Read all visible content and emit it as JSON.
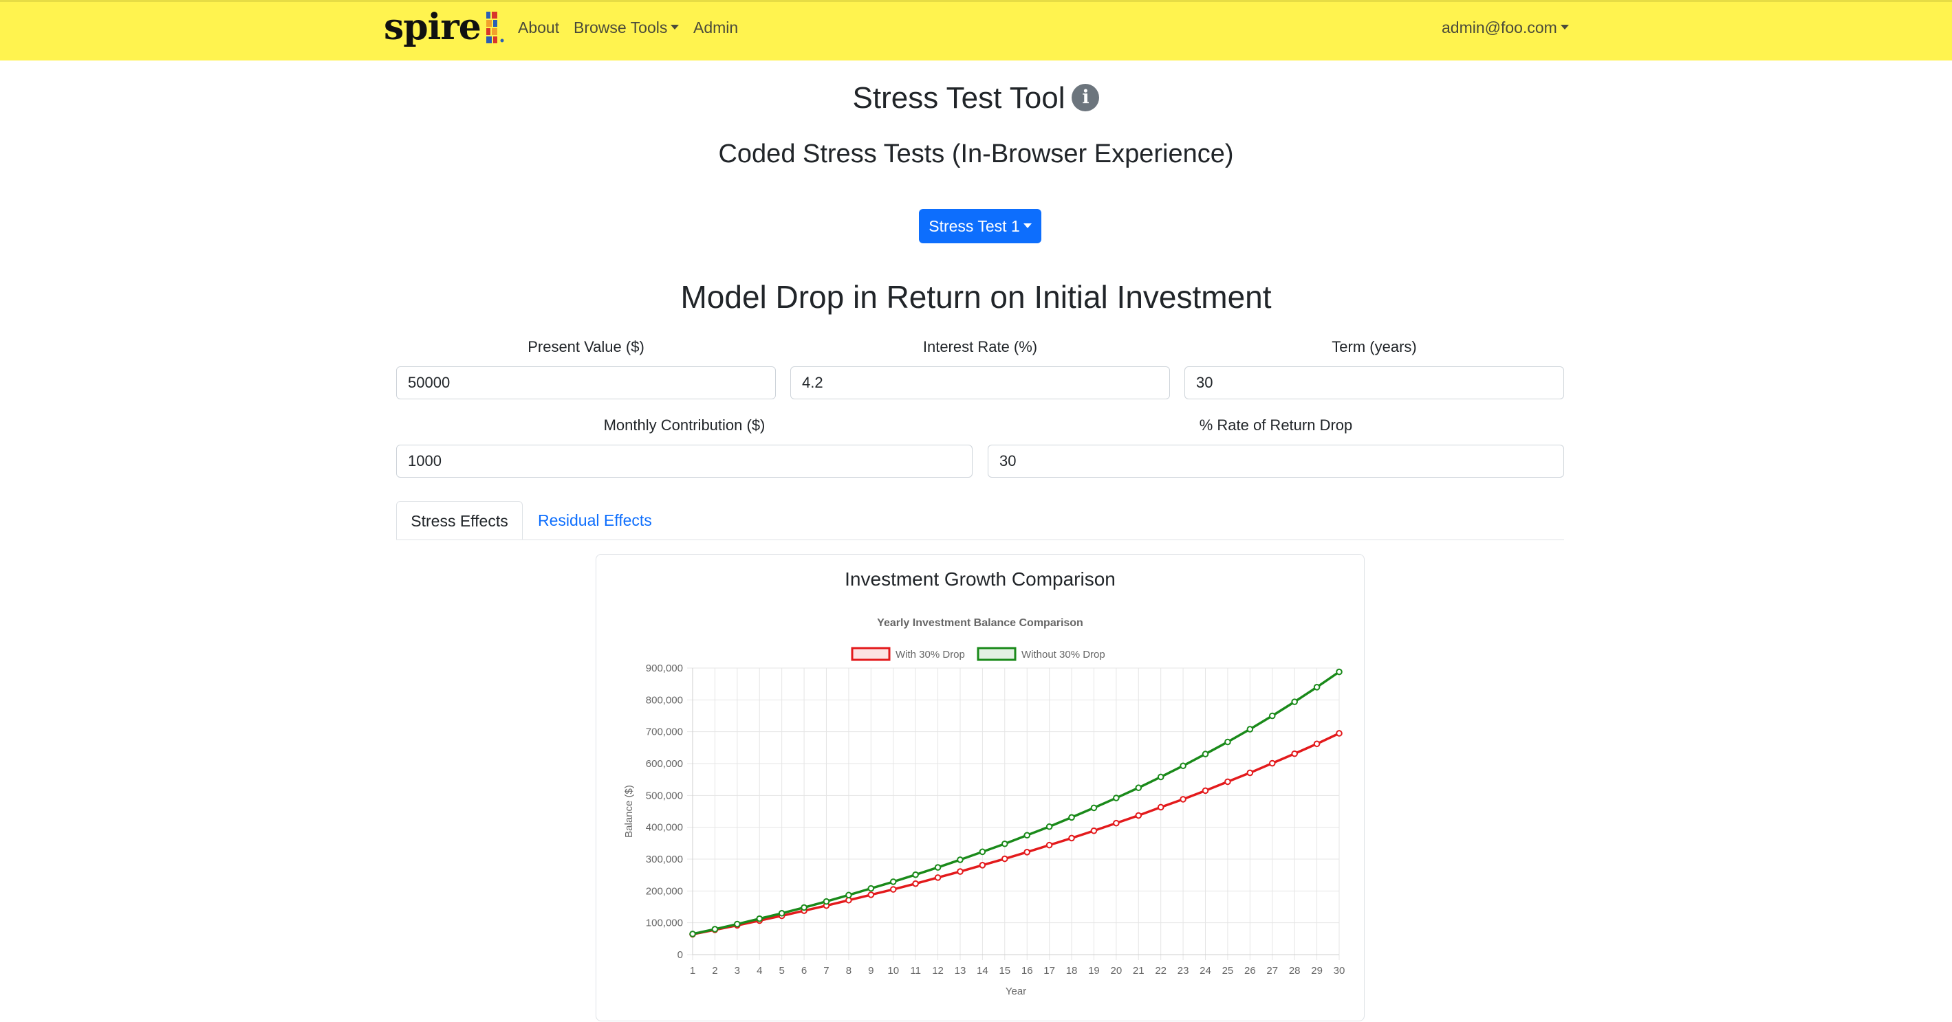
{
  "nav": {
    "brand": "spire",
    "items": [
      {
        "label": "About",
        "dropdown": false
      },
      {
        "label": "Browse Tools",
        "dropdown": true
      },
      {
        "label": "Admin",
        "dropdown": false
      }
    ],
    "user": "admin@foo.com"
  },
  "page": {
    "title": "Stress Test Tool",
    "subtitle": "Coded Stress Tests (In-Browser Experience)",
    "dropdown_label": "Stress Test 1",
    "section_title": "Model Drop in Return on Initial Investment"
  },
  "form": {
    "present_value": {
      "label": "Present Value ($)",
      "value": "50000"
    },
    "interest_rate": {
      "label": "Interest Rate (%)",
      "value": "4.2"
    },
    "term": {
      "label": "Term (years)",
      "value": "30"
    },
    "monthly_contribution": {
      "label": "Monthly Contribution ($)",
      "value": "1000"
    },
    "rate_drop": {
      "label": "% Rate of Return Drop",
      "value": "30"
    }
  },
  "tabs": [
    {
      "label": "Stress Effects",
      "active": true
    },
    {
      "label": "Residual Effects",
      "active": false
    }
  ],
  "card": {
    "title": "Investment Growth Comparison"
  },
  "colors": {
    "navbar": "#fff34f",
    "primary": "#0d6efd",
    "with_drop": "#e31a1c",
    "without_drop": "#1a8a1a"
  },
  "chart_data": {
    "type": "line",
    "title": "Yearly Investment Balance Comparison",
    "xlabel": "Year",
    "ylabel": "Balance ($)",
    "ylim": [
      0,
      900000
    ],
    "yticks": [
      0,
      100000,
      200000,
      300000,
      400000,
      500000,
      600000,
      700000,
      800000,
      900000
    ],
    "grid": true,
    "legend_position": "top",
    "x": [
      1,
      2,
      3,
      4,
      5,
      6,
      7,
      8,
      9,
      10,
      11,
      12,
      13,
      14,
      15,
      16,
      17,
      18,
      19,
      20,
      21,
      22,
      23,
      24,
      25,
      26,
      27,
      28,
      29,
      30
    ],
    "series": [
      {
        "name": "With 30% Drop",
        "color": "#e31a1c",
        "values": [
          64000,
          78000,
          92000,
          107000,
          122000,
          138000,
          154000,
          171000,
          188000,
          205000,
          223000,
          242000,
          261000,
          281000,
          301000,
          322000,
          344000,
          366000,
          389000,
          413000,
          437000,
          463000,
          488000,
          515000,
          543000,
          571000,
          601000,
          631000,
          662000,
          695000
        ]
      },
      {
        "name": "Without 30% Drop",
        "color": "#1a8a1a",
        "values": [
          65000,
          80000,
          96000,
          113000,
          130000,
          148000,
          167000,
          187000,
          208000,
          229000,
          251000,
          274000,
          298000,
          323000,
          348000,
          375000,
          402000,
          431000,
          461000,
          492000,
          524000,
          558000,
          593000,
          630000,
          668000,
          708000,
          750000,
          794000,
          840000,
          888000
        ]
      }
    ]
  }
}
